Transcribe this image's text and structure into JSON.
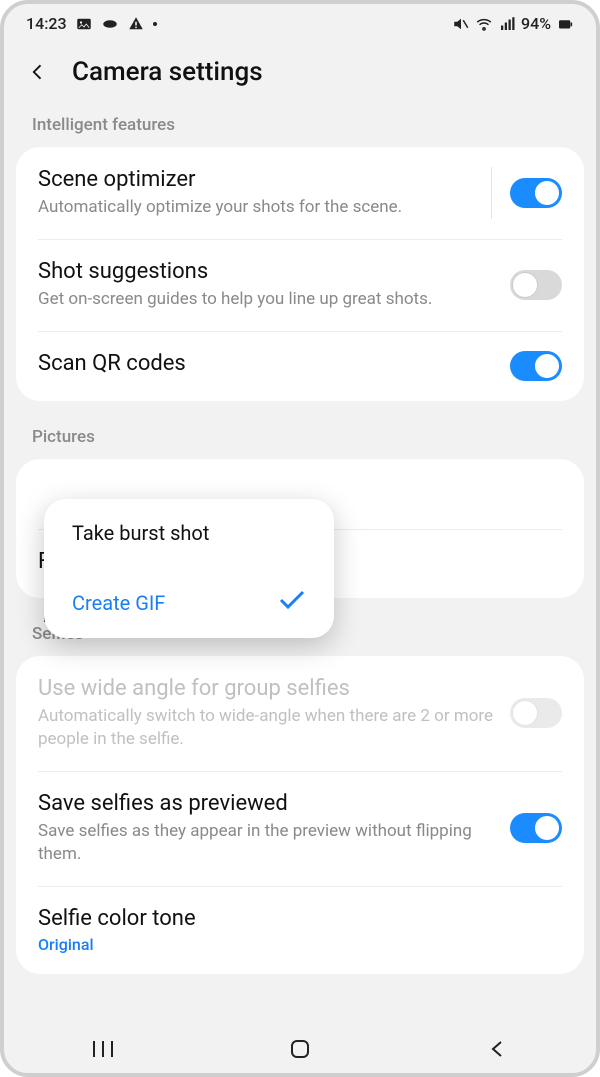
{
  "status": {
    "time": "14:23",
    "battery": "94%"
  },
  "header": {
    "title": "Camera settings"
  },
  "sections": {
    "intelligent": {
      "label": "Intelligent features",
      "scene": {
        "title": "Scene optimizer",
        "desc": "Automatically optimize your shots for the scene."
      },
      "shot": {
        "title": "Shot suggestions",
        "desc": "Get on-screen guides to help you line up great shots."
      },
      "qr": {
        "title": "Scan QR codes"
      }
    },
    "pictures": {
      "label": "Pictures",
      "format": {
        "title": "Format and advanced options"
      }
    },
    "selfies": {
      "label": "Selfies",
      "wide": {
        "title": "Use wide angle for group selfies",
        "desc": "Automatically switch to wide-angle when there are 2 or more people in the selfie."
      },
      "save": {
        "title": "Save selfies as previewed",
        "desc": "Save selfies as they appear in the preview without flipping them."
      },
      "tone": {
        "title": "Selfie color tone",
        "value": "Original"
      }
    }
  },
  "popup": {
    "burst": "Take burst shot",
    "gif": "Create GIF"
  }
}
